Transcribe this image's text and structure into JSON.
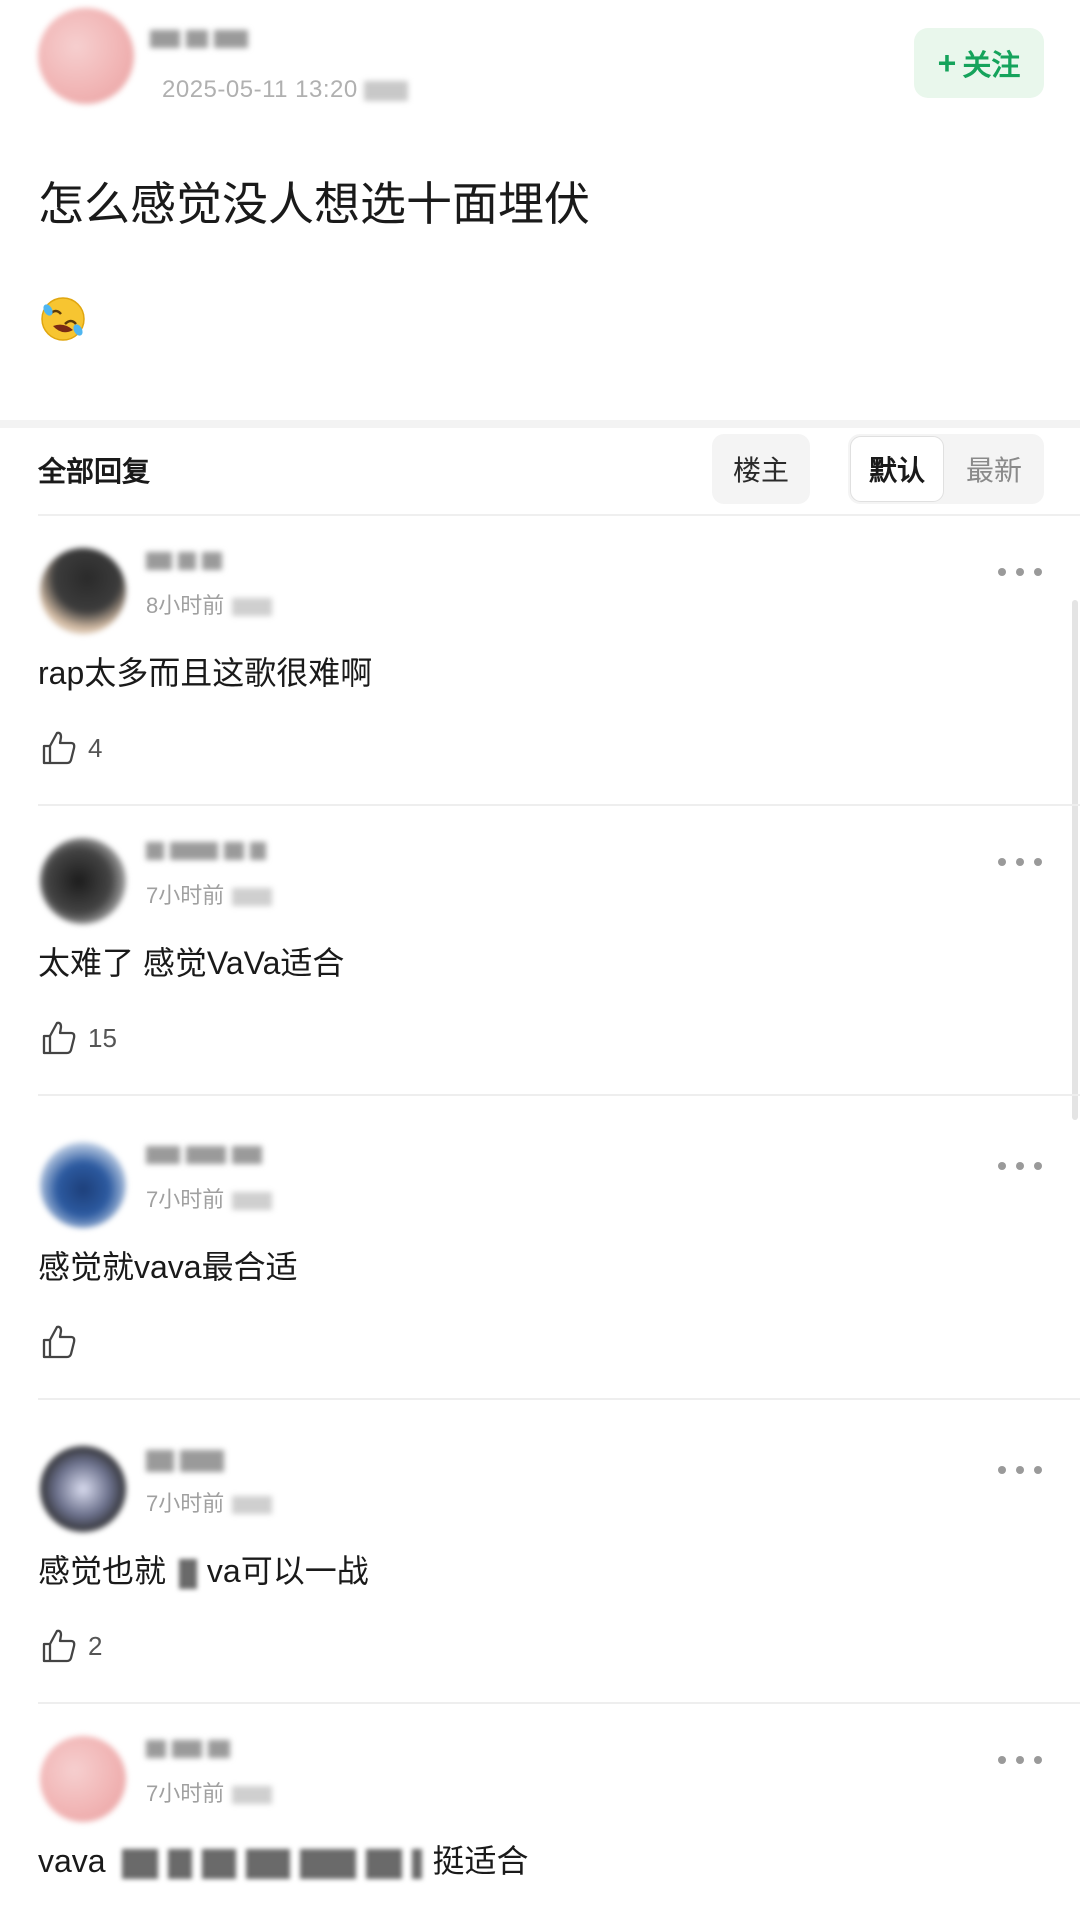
{
  "post": {
    "timestamp": "2025-05-11 13:20",
    "follow_label": "关注",
    "title": "怎么感觉没人想选十面埋伏",
    "emoji_icon": "rolling-on-floor-laughing"
  },
  "replies": {
    "section_title": "全部回复",
    "tab_owner": "楼主",
    "tab_default": "默认",
    "tab_latest": "最新"
  },
  "comments": [
    {
      "time": "8小时前",
      "text": "rap太多而且这歌很难啊",
      "likes": "4"
    },
    {
      "time": "7小时前",
      "text": "太难了 感觉VaVa适合",
      "likes": "15"
    },
    {
      "time": "7小时前",
      "text": "感觉就vava最合适",
      "likes": ""
    },
    {
      "time": "7小时前",
      "text_before": "感觉也就",
      "text_after": "va可以一战",
      "likes": "2"
    },
    {
      "time": "7小时前",
      "text_before": "vava",
      "text_after": "挺适合",
      "likes": ""
    }
  ],
  "colors": {
    "follow_green": "#15a35b",
    "follow_bg": "#e9f7ec",
    "muted_text": "#a0a0a0"
  }
}
